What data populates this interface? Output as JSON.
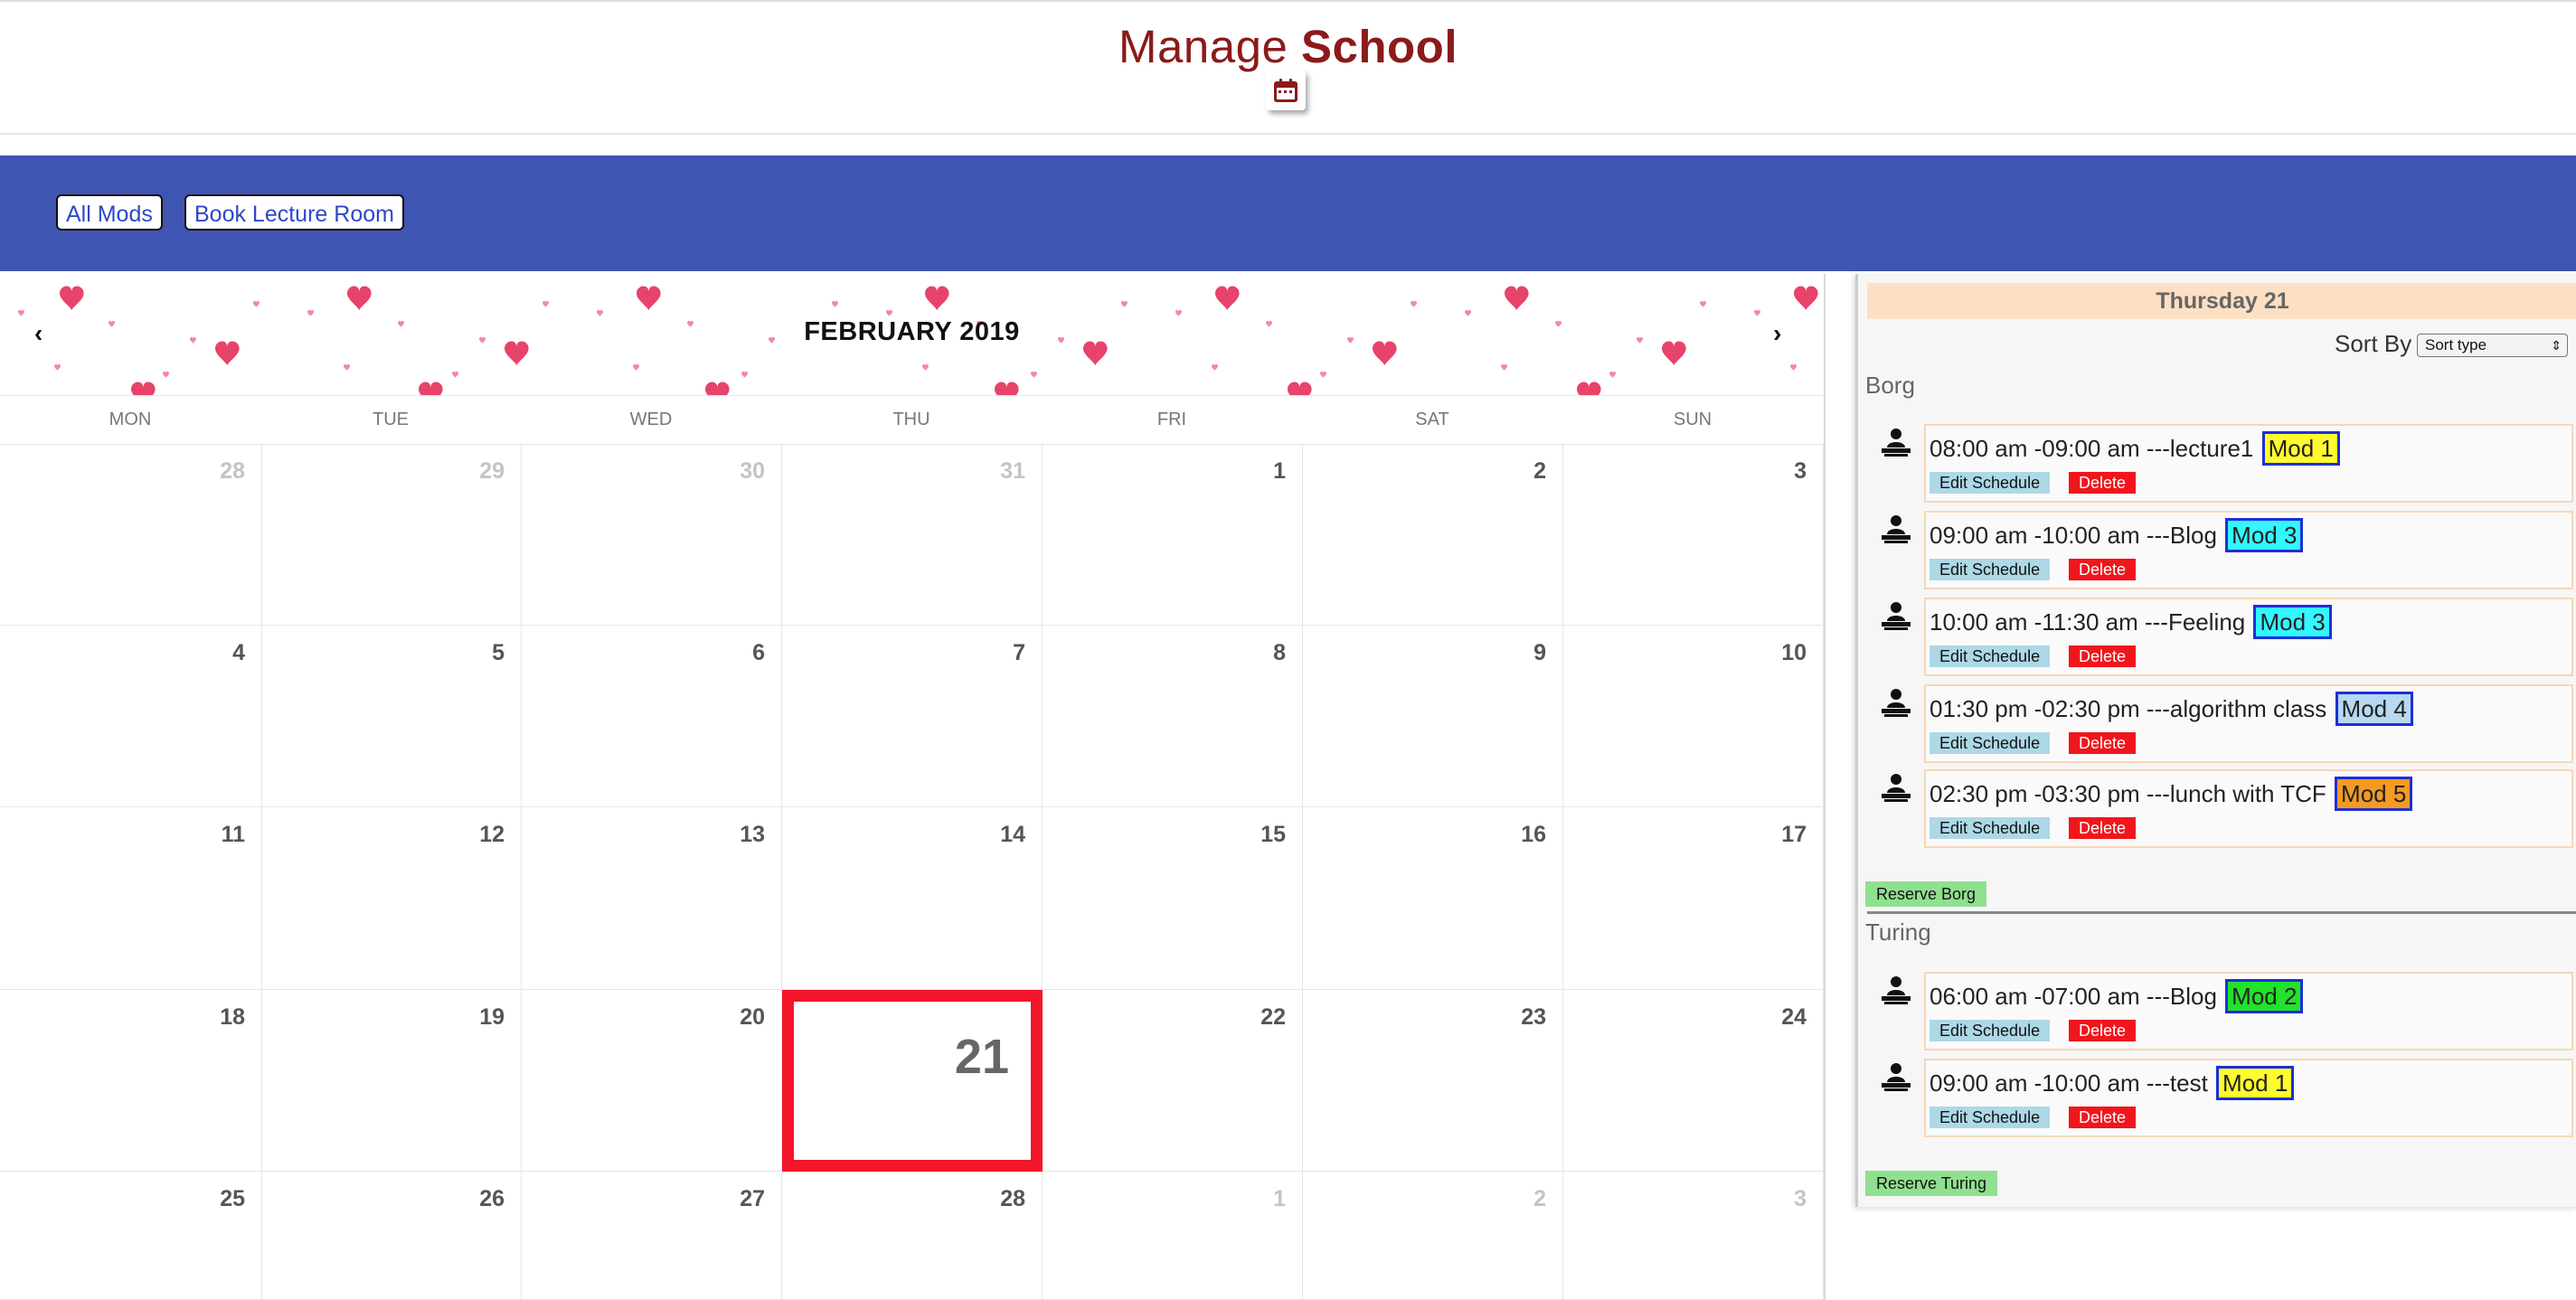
{
  "header": {
    "title_light": "Manage",
    "title_bold": "School"
  },
  "nav": {
    "all_mods": "All Mods",
    "book_room": "Book Lecture Room"
  },
  "calendar": {
    "month_title": "FEBRUARY 2019",
    "weekdays": [
      "MON",
      "TUE",
      "WED",
      "THU",
      "FRI",
      "SAT",
      "SUN"
    ],
    "weeks": [
      [
        "28",
        "29",
        "30",
        "31",
        "1",
        "2",
        "3"
      ],
      [
        "4",
        "5",
        "6",
        "7",
        "8",
        "9",
        "10"
      ],
      [
        "11",
        "12",
        "13",
        "14",
        "15",
        "16",
        "17"
      ],
      [
        "18",
        "19",
        "20",
        "21",
        "22",
        "23",
        "24"
      ],
      [
        "25",
        "26",
        "27",
        "28",
        "1",
        "2",
        "3"
      ]
    ],
    "selected_day": "21"
  },
  "panel": {
    "day_title": "Thursday 21",
    "sort_label": "Sort By",
    "sort_value": "Sort type",
    "edit_label": "Edit Schedule",
    "delete_label": "Delete",
    "rooms": [
      {
        "name": "Borg",
        "reserve_label": "Reserve Borg",
        "schedules": [
          {
            "text": "08:00 am -09:00 am ---lecture1",
            "mod": "Mod 1",
            "mod_color": "#fffb2e"
          },
          {
            "text": "09:00 am -10:00 am ---Blog",
            "mod": "Mod 3",
            "mod_color": "#33f6ff"
          },
          {
            "text": "10:00 am -11:30 am ---Feeling",
            "mod": "Mod 3",
            "mod_color": "#33f6ff"
          },
          {
            "text": "01:30 pm -02:30 pm ---algorithm class",
            "mod": "Mod 4",
            "mod_color": "#b6d8f0"
          },
          {
            "text": "02:30 pm -03:30 pm ---lunch with TCF",
            "mod": "Mod 5",
            "mod_color": "#f59a23"
          }
        ]
      },
      {
        "name": "Turing",
        "reserve_label": "Reserve Turing",
        "schedules": [
          {
            "text": "06:00 am -07:00 am ---Blog",
            "mod": "Mod 2",
            "mod_color": "#22e22a"
          },
          {
            "text": "09:00 am -10:00 am ---test",
            "mod": "Mod 1",
            "mod_color": "#fffb2e"
          }
        ]
      }
    ]
  }
}
